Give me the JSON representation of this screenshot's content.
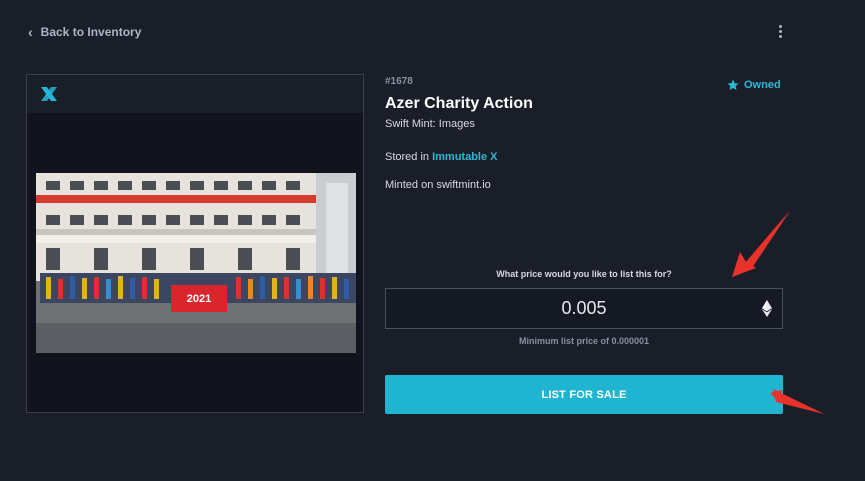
{
  "nav": {
    "back_label": "Back to Inventory"
  },
  "asset": {
    "token_id": "#1678",
    "owned_label": "Owned",
    "name": "Azer Charity Action",
    "collection": "Swift Mint: Images",
    "stored_prefix": "Stored in ",
    "stored_link": "Immutable X",
    "minted_on": "Minted on swiftmint.io",
    "image_banner_text": "2021"
  },
  "listing": {
    "question": "What price would you like to list this for?",
    "price_value": "0.005",
    "currency_icon": "ethereum-icon",
    "min_price": "Minimum list price of 0.000001",
    "button_label": "LIST FOR SALE"
  },
  "colors": {
    "background": "#1a1e29",
    "accent": "#1fb4cf",
    "link": "#2ab9d6",
    "annotation_arrow": "#e8322a"
  },
  "icons": [
    "chevron-left-icon",
    "more-vertical-icon",
    "immutable-x-logo",
    "star-icon",
    "ethereum-icon",
    "red-arrow-annotation"
  ]
}
